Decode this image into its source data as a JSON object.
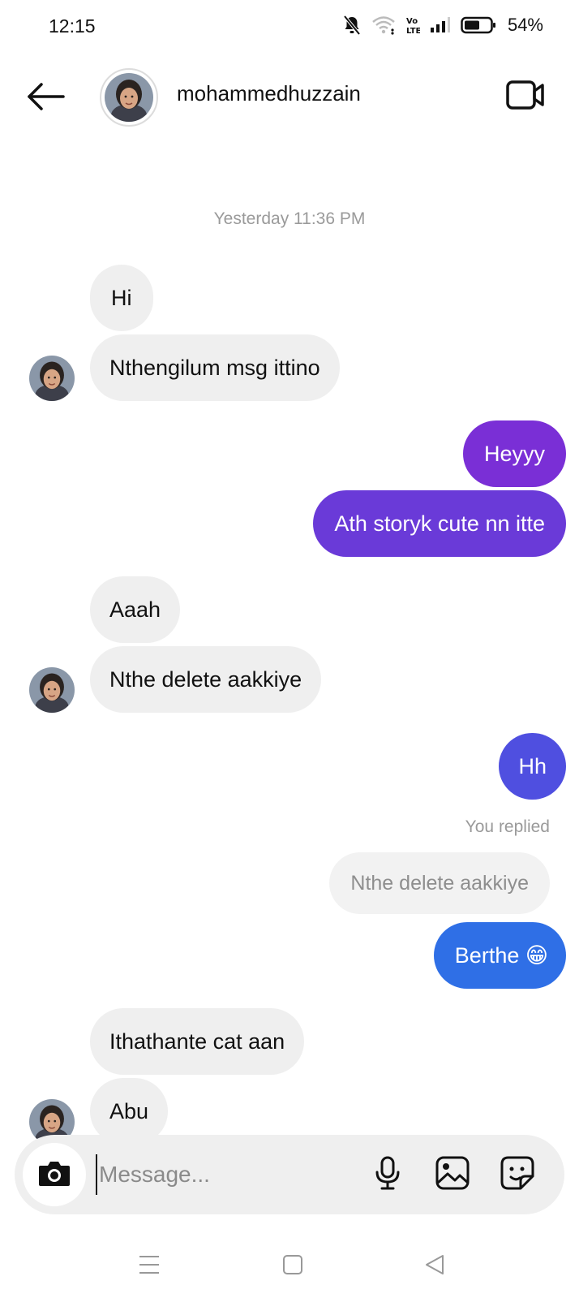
{
  "status_bar": {
    "time": "12:15",
    "battery": "54%",
    "icons": [
      "mute-bell-icon",
      "wifi-icon",
      "volte-icon",
      "signal-icon",
      "battery-icon"
    ]
  },
  "header": {
    "username": "mohammedhuzzain",
    "back_icon": "arrow-left-icon",
    "video_icon": "video-call-icon"
  },
  "thread": {
    "timestamp": "Yesterday 11:36 PM",
    "messages": [
      {
        "from": "them",
        "text": "Hi"
      },
      {
        "from": "them",
        "text": "Nthengilum msg ittino"
      },
      {
        "from": "me",
        "text": "Heyyy"
      },
      {
        "from": "me",
        "text": "Ath storyk cute nn itte"
      },
      {
        "from": "them",
        "text": "Aaah"
      },
      {
        "from": "them",
        "text": "Nthe delete aakkiye"
      },
      {
        "from": "me",
        "text": "Hh"
      },
      {
        "from": "me",
        "text": "Berthe 😁",
        "reply_label": "You replied",
        "reply_quote": "Nthe delete aakkiye"
      },
      {
        "from": "them",
        "text": "Ithathante cat aan"
      },
      {
        "from": "them",
        "text": "Abu"
      }
    ],
    "outgoing_colors": [
      "#7a2fd6",
      "#6a3ad8",
      "#4f4fe0",
      "#2f6fe6"
    ]
  },
  "composer": {
    "placeholder": "Message...",
    "value": "",
    "icons": [
      "camera-icon",
      "microphone-icon",
      "gallery-icon",
      "sticker-icon"
    ]
  },
  "nav_bar": {
    "icons": [
      "menu-lines-icon",
      "home-square-icon",
      "back-triangle-icon"
    ]
  }
}
